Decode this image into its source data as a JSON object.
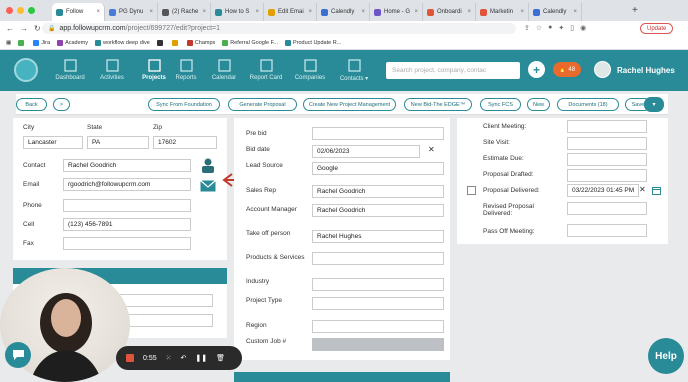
{
  "browser": {
    "tabs": [
      {
        "label": "Follow",
        "color": "#2a8b98",
        "active": true
      },
      {
        "label": "PG Dynu",
        "color": "#4a7bd6"
      },
      {
        "label": "(2) Rache",
        "color": "#555"
      },
      {
        "label": "How to S",
        "color": "#2a8b98"
      },
      {
        "label": "Edit Emai",
        "color": "#e0a000"
      },
      {
        "label": "Calendly",
        "color": "#3a6fd6"
      },
      {
        "label": "Home - G",
        "color": "#6d55c8"
      },
      {
        "label": "Onboardi",
        "color": "#e0553a"
      },
      {
        "label": "Marketin",
        "color": "#e0553a"
      },
      {
        "label": "Calendly",
        "color": "#3a6fd6"
      }
    ],
    "url_host": "app.followupcrm.com",
    "url_path": "/project/699727/edit?project=1",
    "update_label": "Update",
    "bookmarks": [
      {
        "label": "",
        "color": "#4caf50"
      },
      {
        "label": "Jira",
        "color": "#2684ff"
      },
      {
        "label": "Academy",
        "color": "#8e44ad"
      },
      {
        "label": "workflow deep dive",
        "color": "#2a8b98"
      },
      {
        "label": "",
        "color": "#333"
      },
      {
        "label": "",
        "color": "#e0a000"
      },
      {
        "label": "Champs",
        "color": "#c0392b"
      },
      {
        "label": "Referral Google F...",
        "color": "#4caf50"
      },
      {
        "label": "Product Update R...",
        "color": "#2a8b98"
      }
    ]
  },
  "nav": {
    "items": [
      {
        "label": "Dashboard",
        "active": false
      },
      {
        "label": "Activities",
        "active": false
      },
      {
        "label": "Projects",
        "active": true
      },
      {
        "label": "Reports",
        "active": false
      },
      {
        "label": "Calendar",
        "active": false
      },
      {
        "label": "Report Card",
        "active": false
      },
      {
        "label": "Companies",
        "active": false
      },
      {
        "label": "Contacts ▾",
        "active": false
      }
    ],
    "search_placeholder": "Search project, company, contac",
    "notif_count": "48",
    "user_name": "Rachel Hughes"
  },
  "actions": {
    "back": "Back",
    "next": ">",
    "buttons": [
      "Sync From Foundation",
      "Generate Proposal",
      "Create New Project Management",
      "New Bid-The EDGE™",
      "Sync FCS",
      "New",
      "Documents (18)",
      "Save"
    ],
    "menu": "▾"
  },
  "contact": {
    "city_label": "City",
    "city": "Lancaster",
    "state_label": "State",
    "state": "PA",
    "zip_label": "Zip",
    "zip": "17602",
    "contact_label": "Contact",
    "contact": "Rachel Goodrich",
    "email_label": "Email",
    "email": "rgoodrich@followupcrm.com",
    "phone_label": "Phone",
    "phone": "",
    "cell_label": "Cell",
    "cell": "(123) 456-7891",
    "fax_label": "Fax",
    "fax": ""
  },
  "project": {
    "prebid_label": "Pre bid",
    "prebid": "",
    "biddate_label": "Bid date",
    "biddate": "02/06/2023",
    "lead_label": "Lead Source",
    "lead": "Google",
    "salesrep_label": "Sales Rep",
    "salesrep": "Rachel Goodrich",
    "am_label": "Account Manager",
    "am": "Rachel Goodrich",
    "takeoff_label": "Take off person",
    "takeoff": "Rachel Hughes",
    "products_label": "Products & Services",
    "industry_label": "Industry",
    "type_label": "Project Type",
    "region_label": "Region",
    "custom_label": "Custom Job #"
  },
  "dates": {
    "client_label": "Client Meeting:",
    "site_label": "Site Visit:",
    "estimate_label": "Estimate Due:",
    "drafted_label": "Proposal Drafted:",
    "delivered_label": "Proposal Delivered:",
    "delivered": "03/22/2023 01:45 PM",
    "revised_label": "Revised Proposal Delivered:",
    "handoff_label": "Pass Off Meeting:"
  },
  "recorder": {
    "time": "0:55"
  },
  "help_label": "Help"
}
